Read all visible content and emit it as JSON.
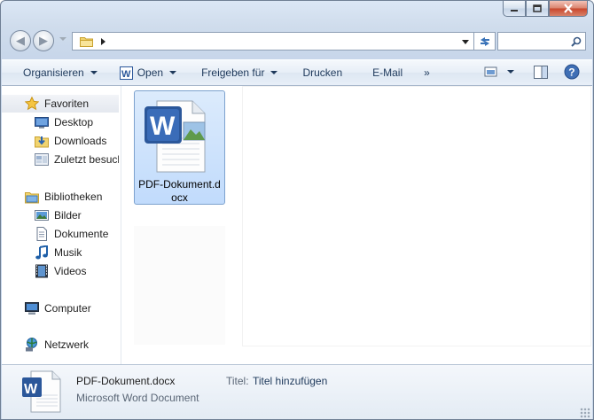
{
  "window": {
    "caption_buttons": [
      "minimize",
      "maximize",
      "close"
    ]
  },
  "navigation": {
    "address_path": "",
    "search_placeholder": ""
  },
  "toolbar": {
    "organize": "Organisieren",
    "open": "Open",
    "share": "Freigeben für",
    "print": "Drucken",
    "email": "E-Mail",
    "more": "»"
  },
  "sidebar": {
    "favorites": {
      "label": "Favoriten",
      "icon": "star-icon"
    },
    "favorite_items": [
      {
        "label": "Desktop",
        "icon": "desktop-icon"
      },
      {
        "label": "Downloads",
        "icon": "downloads-icon"
      },
      {
        "label": "Zuletzt besucht",
        "icon": "recent-places-icon"
      }
    ],
    "libraries": {
      "label": "Bibliotheken",
      "icon": "library-icon"
    },
    "library_items": [
      {
        "label": "Bilder",
        "icon": "pictures-icon"
      },
      {
        "label": "Dokumente",
        "icon": "documents-icon"
      },
      {
        "label": "Musik",
        "icon": "music-icon"
      },
      {
        "label": "Videos",
        "icon": "videos-icon"
      }
    ],
    "computer": {
      "label": "Computer",
      "icon": "computer-icon"
    },
    "network": {
      "label": "Netzwerk",
      "icon": "network-icon"
    }
  },
  "content": {
    "files": [
      {
        "name_line1": "PDF-Dokument.d",
        "name_line2": "ocx",
        "icon": "word-document-icon",
        "selected": true
      }
    ]
  },
  "details": {
    "file_name": "PDF-Dokument.docx",
    "file_type": "Microsoft Word Document",
    "title_label": "Titel:",
    "title_value": "Titel hinzufügen"
  },
  "colors": {
    "selection_bg": "#c1dbfc",
    "selection_border": "#7da2ce",
    "toolbar_text": "#1e395b",
    "word_blue": "#2b579a"
  }
}
